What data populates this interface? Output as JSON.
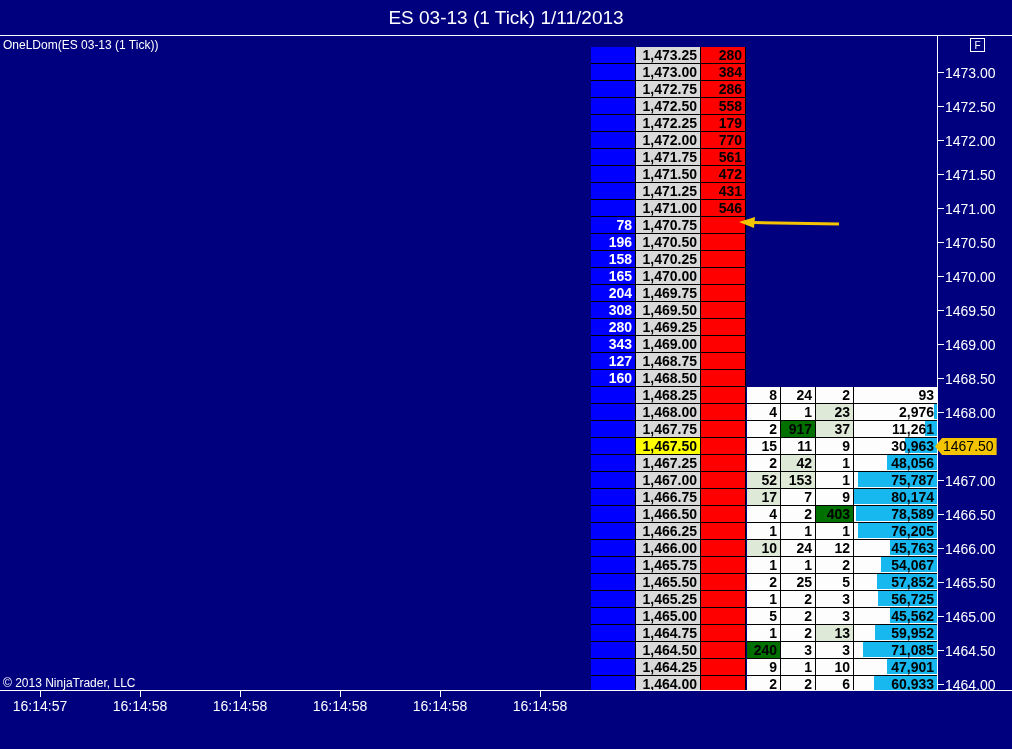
{
  "window": {
    "title": "ES 03-13 (1 Tick)  1/11/2013"
  },
  "indicator_label": "OneLDom(ES 03-13 (1 Tick))",
  "price_axis": {
    "button": "F",
    "current_price": "1467.50"
  },
  "copyright": "© 2013 NinjaTrader, LLC",
  "ladder": [
    {
      "price": "1,473.25",
      "ask": "280",
      "last_price": false
    },
    {
      "price": "1,473.00",
      "ask": "384",
      "last_price": false,
      "axis_label": "1473.00"
    },
    {
      "price": "1,472.75",
      "ask": "286",
      "last_price": false
    },
    {
      "price": "1,472.50",
      "ask": "558",
      "last_price": false,
      "axis_label": "1472.50"
    },
    {
      "price": "1,472.25",
      "ask": "179",
      "last_price": false
    },
    {
      "price": "1,472.00",
      "ask": "770",
      "last_price": false,
      "axis_label": "1472.00"
    },
    {
      "price": "1,471.75",
      "ask": "561",
      "last_price": false
    },
    {
      "price": "1,471.50",
      "ask": "472",
      "last_price": false,
      "axis_label": "1471.50"
    },
    {
      "price": "1,471.25",
      "ask": "431",
      "last_price": false
    },
    {
      "price": "1,471.00",
      "ask": "546",
      "last_price": false,
      "axis_label": "1471.00"
    },
    {
      "price": "1,470.75",
      "bid": "78",
      "last_price": false
    },
    {
      "price": "1,470.50",
      "bid": "196",
      "last_price": false,
      "axis_label": "1470.50"
    },
    {
      "price": "1,470.25",
      "bid": "158",
      "last_price": false
    },
    {
      "price": "1,470.00",
      "bid": "165",
      "last_price": false,
      "axis_label": "1470.00"
    },
    {
      "price": "1,469.75",
      "bid": "204",
      "last_price": false
    },
    {
      "price": "1,469.50",
      "bid": "308",
      "last_price": false,
      "axis_label": "1469.50"
    },
    {
      "price": "1,469.25",
      "bid": "280",
      "last_price": false
    },
    {
      "price": "1,469.00",
      "bid": "343",
      "last_price": false,
      "axis_label": "1469.00"
    },
    {
      "price": "1,468.75",
      "bid": "127",
      "last_price": false
    },
    {
      "price": "1,468.50",
      "bid": "160",
      "last_price": false,
      "axis_label": "1468.50"
    },
    {
      "price": "1,468.25",
      "last_price": false,
      "trades": [
        {
          "text": "8",
          "color": "#fdfdfd"
        },
        {
          "text": "24",
          "color": "#fdfdfd"
        },
        {
          "text": "2",
          "color": "#fdfdfd"
        }
      ],
      "volume": "93"
    },
    {
      "price": "1,468.00",
      "last_price": false,
      "axis_label": "1468.00",
      "trades": [
        {
          "text": "4",
          "color": "#fdfdfd"
        },
        {
          "text": "1",
          "color": "#fdfdfd"
        },
        {
          "text": "23",
          "color": "#dfe9d8"
        }
      ],
      "volume": "2,976",
      "level": 0.04
    },
    {
      "price": "1,467.75",
      "last_price": false,
      "trades": [
        {
          "text": "2",
          "color": "#fdfdfd"
        },
        {
          "text": "917",
          "color": "#007000"
        },
        {
          "text": "37",
          "color": "#dfe9d8"
        }
      ],
      "volume": "11,261",
      "level": 0.14
    },
    {
      "price": "1,467.50",
      "last_price": true,
      "trades": [
        {
          "text": "15",
          "color": "#fdfdfd"
        },
        {
          "text": "11",
          "color": "#fdfdfd"
        },
        {
          "text": "9",
          "color": "#fdfdfd"
        }
      ],
      "volume": "30,963",
      "level": 0.39
    },
    {
      "price": "1,467.25",
      "last_price": false,
      "trades": [
        {
          "text": "2",
          "color": "#fdfdfd"
        },
        {
          "text": "42",
          "color": "#dfe9d8"
        },
        {
          "text": "1",
          "color": "#fdfdfd"
        }
      ],
      "volume": "48,056",
      "level": 0.6
    },
    {
      "price": "1,467.00",
      "last_price": false,
      "axis_label": "1467.00",
      "trades": [
        {
          "text": "52",
          "color": "#dfe9d8"
        },
        {
          "text": "153",
          "color": "#dfe9d8"
        },
        {
          "text": "1",
          "color": "#fdfdfd"
        }
      ],
      "volume": "75,787",
      "level": 0.95
    },
    {
      "price": "1,466.75",
      "last_price": false,
      "trades": [
        {
          "text": "17",
          "color": "#dfe9d8"
        },
        {
          "text": "7",
          "color": "#fdfdfd"
        },
        {
          "text": "9",
          "color": "#fdfdfd"
        }
      ],
      "volume": "80,174",
      "level": 1.0
    },
    {
      "price": "1,466.50",
      "last_price": false,
      "axis_label": "1466.50",
      "trades": [
        {
          "text": "4",
          "color": "#fdfdfd"
        },
        {
          "text": "2",
          "color": "#fdfdfd"
        },
        {
          "text": "403",
          "color": "#007000"
        }
      ],
      "volume": "78,589",
      "level": 0.98
    },
    {
      "price": "1,466.25",
      "last_price": false,
      "trades": [
        {
          "text": "1",
          "color": "#fdfdfd"
        },
        {
          "text": "1",
          "color": "#fdfdfd"
        },
        {
          "text": "1",
          "color": "#fdfdfd"
        }
      ],
      "volume": "76,205",
      "level": 0.95
    },
    {
      "price": "1,466.00",
      "last_price": false,
      "axis_label": "1466.00",
      "trades": [
        {
          "text": "10",
          "color": "#dfe9d8"
        },
        {
          "text": "24",
          "color": "#fdfdfd"
        },
        {
          "text": "12",
          "color": "#fdfdfd"
        }
      ],
      "volume": "45,763",
      "level": 0.57
    },
    {
      "price": "1,465.75",
      "last_price": false,
      "trades": [
        {
          "text": "1",
          "color": "#fdfdfd"
        },
        {
          "text": "1",
          "color": "#fdfdfd"
        },
        {
          "text": "2",
          "color": "#fdfdfd"
        }
      ],
      "volume": "54,067",
      "level": 0.67
    },
    {
      "price": "1,465.50",
      "last_price": false,
      "axis_label": "1465.50",
      "trades": [
        {
          "text": "2",
          "color": "#fdfdfd"
        },
        {
          "text": "25",
          "color": "#fdfdfd"
        },
        {
          "text": "5",
          "color": "#fdfdfd"
        }
      ],
      "volume": "57,852",
      "level": 0.72
    },
    {
      "price": "1,465.25",
      "last_price": false,
      "trades": [
        {
          "text": "1",
          "color": "#fdfdfd"
        },
        {
          "text": "2",
          "color": "#fdfdfd"
        },
        {
          "text": "3",
          "color": "#fdfdfd"
        }
      ],
      "volume": "56,725",
      "level": 0.71
    },
    {
      "price": "1,465.00",
      "last_price": false,
      "axis_label": "1465.00",
      "trades": [
        {
          "text": "5",
          "color": "#fdfdfd"
        },
        {
          "text": "2",
          "color": "#fdfdfd"
        },
        {
          "text": "3",
          "color": "#fdfdfd"
        }
      ],
      "volume": "45,562",
      "level": 0.57
    },
    {
      "price": "1,464.75",
      "last_price": false,
      "trades": [
        {
          "text": "1",
          "color": "#fdfdfd"
        },
        {
          "text": "2",
          "color": "#fdfdfd"
        },
        {
          "text": "13",
          "color": "#dfe9d8"
        }
      ],
      "volume": "59,952",
      "level": 0.75
    },
    {
      "price": "1,464.50",
      "last_price": false,
      "axis_label": "1464.50",
      "trades": [
        {
          "text": "240",
          "color": "#007000"
        },
        {
          "text": "3",
          "color": "#fdfdfd"
        },
        {
          "text": "3",
          "color": "#fdfdfd"
        }
      ],
      "volume": "71,085",
      "level": 0.89
    },
    {
      "price": "1,464.25",
      "last_price": false,
      "trades": [
        {
          "text": "9",
          "color": "#fdfdfd"
        },
        {
          "text": "1",
          "color": "#fdfdfd"
        },
        {
          "text": "10",
          "color": "#fdfdfd"
        }
      ],
      "volume": "47,901",
      "level": 0.6
    },
    {
      "price": "1,464.00",
      "last_price": false,
      "axis_label": "1464.00",
      "trades": [
        {
          "text": "2",
          "color": "#fdfdfd"
        },
        {
          "text": "2",
          "color": "#fdfdfd"
        },
        {
          "text": "6",
          "color": "#fdfdfd"
        }
      ],
      "volume": "60,933",
      "level": 0.76
    }
  ],
  "time_axis": [
    "16:14:57",
    "16:14:58",
    "16:14:58",
    "16:14:58",
    "16:14:58",
    "16:14:58"
  ]
}
